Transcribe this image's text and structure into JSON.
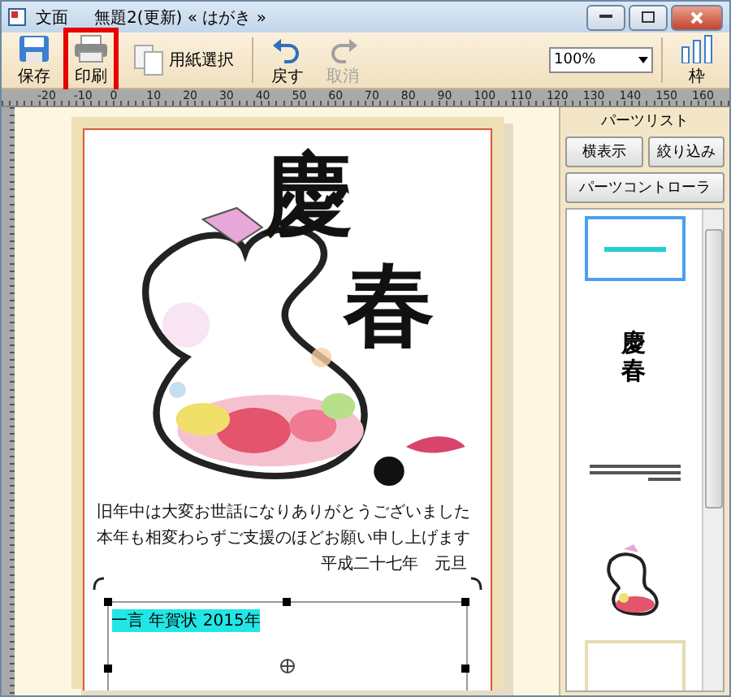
{
  "window": {
    "app_name": "文面",
    "document": "無題2(更新)  « はがき »"
  },
  "toolbar": {
    "buttons": [
      {
        "kind": "save",
        "label": "保存",
        "disabled": false,
        "highlighted": false
      },
      {
        "kind": "print",
        "label": "印刷",
        "disabled": false,
        "highlighted": true
      },
      {
        "kind": "paper",
        "label": "用紙選択",
        "disabled": false,
        "highlighted": false
      },
      {
        "kind": "undo",
        "label": "戻す",
        "disabled": false,
        "highlighted": false
      },
      {
        "kind": "redo",
        "label": "取消",
        "disabled": true,
        "highlighted": false
      }
    ],
    "zoom": {
      "value": "100%"
    },
    "frame_button": {
      "label": "枠"
    }
  },
  "ruler": {
    "labels": [
      "-20",
      "-10",
      "0",
      "10",
      "20",
      "30",
      "40",
      "50",
      "60",
      "70",
      "80",
      "90",
      "100",
      "110",
      "120",
      "130",
      "140",
      "150",
      "160"
    ]
  },
  "card": {
    "calligraphy": [
      "慶",
      "春"
    ],
    "message": [
      "旧年中は大変お世話になりありがとうございました",
      "本年も相変わらずご支援のほどお願い申し上げます"
    ],
    "signature": "平成二十七年　元旦",
    "selected_text": "一言 年賀状 2015年"
  },
  "panel": {
    "title": "パーツリスト",
    "buttons": [
      "横表示",
      "絞り込み"
    ],
    "controller_button": "パーツコントローラ",
    "thumbnails": [
      {
        "kind": "text",
        "selected": true
      },
      {
        "kind": "calligraphy",
        "selected": false,
        "text": "慶春"
      },
      {
        "kind": "message",
        "selected": false
      },
      {
        "kind": "picture",
        "selected": false
      },
      {
        "kind": "frame",
        "selected": false
      }
    ]
  }
}
